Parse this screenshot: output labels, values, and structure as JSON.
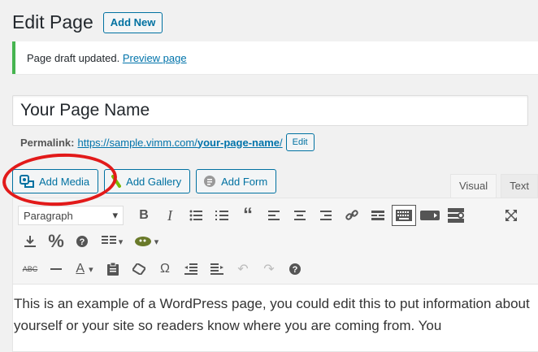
{
  "header": {
    "title": "Edit Page",
    "add_new": "Add New"
  },
  "notice": {
    "text": "Page draft updated.",
    "link": "Preview page"
  },
  "title_field": {
    "value": "Your Page Name"
  },
  "permalink": {
    "label": "Permalink:",
    "base": "https://sample.vimm.com/",
    "slug": "your-page-name",
    "trail": "/",
    "edit": "Edit"
  },
  "media_buttons": [
    {
      "label": "Add Media",
      "icon": "media-icon"
    },
    {
      "label": "Add Gallery",
      "icon": "gallery-icon"
    },
    {
      "label": "Add Form",
      "icon": "form-icon"
    }
  ],
  "tabs": [
    {
      "label": "Visual",
      "active": true
    },
    {
      "label": "Text",
      "active": false
    }
  ],
  "toolbar": {
    "format_select": "Paragraph"
  },
  "content": {
    "text": "This is an example of a WordPress page, you could edit this to put information about yourself or your site so readers know where you are coming from. You"
  },
  "colors": {
    "accent": "#0071a1",
    "notice_border": "#46b450",
    "annotation": "#e21a1a"
  }
}
